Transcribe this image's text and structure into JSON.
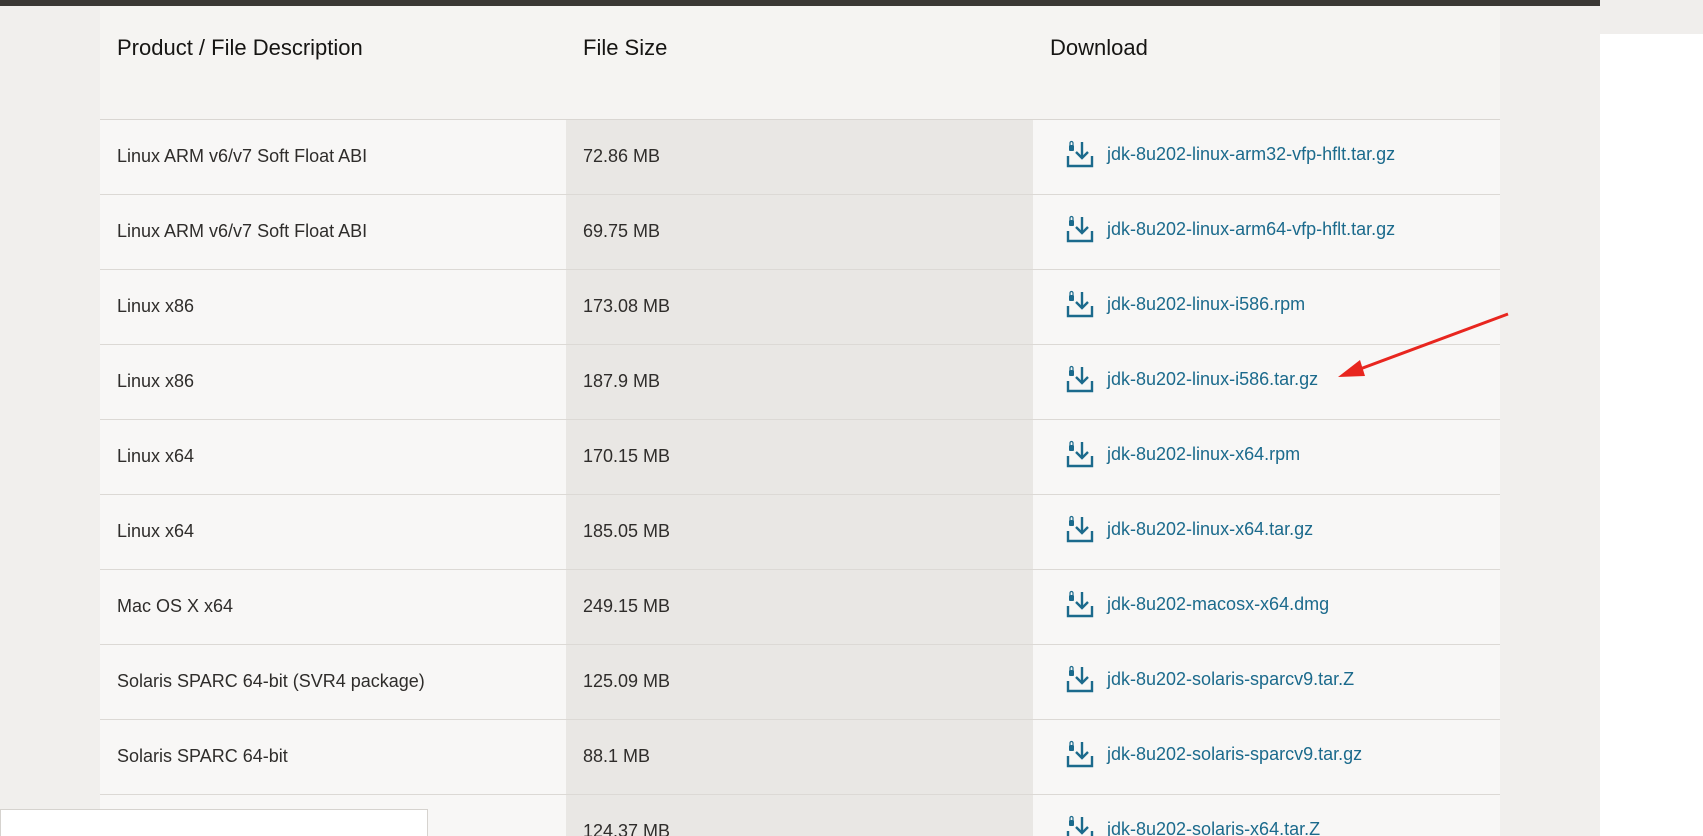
{
  "table": {
    "headers": {
      "description": "Product / File Description",
      "size": "File Size",
      "download": "Download"
    },
    "rows": [
      {
        "description": "Linux ARM v6/v7 Soft Float ABI",
        "size": "72.86 MB",
        "file": "jdk-8u202-linux-arm32-vfp-hflt.tar.gz"
      },
      {
        "description": "Linux ARM v6/v7 Soft Float ABI",
        "size": "69.75 MB",
        "file": "jdk-8u202-linux-arm64-vfp-hflt.tar.gz"
      },
      {
        "description": "Linux x86",
        "size": "173.08 MB",
        "file": "jdk-8u202-linux-i586.rpm"
      },
      {
        "description": "Linux x86",
        "size": "187.9 MB",
        "file": "jdk-8u202-linux-i586.tar.gz"
      },
      {
        "description": "Linux x64",
        "size": "170.15 MB",
        "file": "jdk-8u202-linux-x64.rpm"
      },
      {
        "description": "Linux x64",
        "size": "185.05 MB",
        "file": "jdk-8u202-linux-x64.tar.gz"
      },
      {
        "description": "Mac OS X x64",
        "size": "249.15 MB",
        "file": "jdk-8u202-macosx-x64.dmg"
      },
      {
        "description": "Solaris SPARC 64-bit (SVR4 package)",
        "size": "125.09 MB",
        "file": "jdk-8u202-solaris-sparcv9.tar.Z"
      },
      {
        "description": "Solaris SPARC 64-bit",
        "size": "88.1 MB",
        "file": "jdk-8u202-solaris-sparcv9.tar.gz"
      },
      {
        "description": "",
        "size": "124.37 MB",
        "file": "jdk-8u202-solaris-x64.tar.Z"
      }
    ]
  },
  "icons": {
    "download": "download-icon",
    "annotation": "red-arrow-icon"
  },
  "colors": {
    "link": "#1b6a8c",
    "arrow": "#e8261f"
  }
}
